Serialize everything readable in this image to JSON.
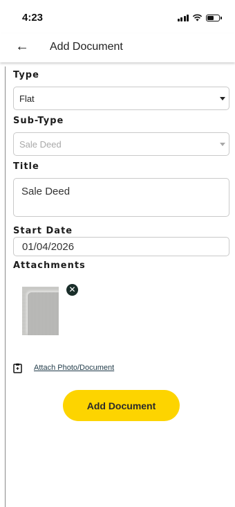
{
  "status_bar": {
    "time": "4:23"
  },
  "header": {
    "title": "Add Document"
  },
  "form": {
    "type": {
      "label": "Type",
      "value": "Flat"
    },
    "sub_type": {
      "label": "Sub-Type",
      "value": "Sale Deed"
    },
    "title": {
      "label": "Title",
      "value": "Sale Deed"
    },
    "start_date": {
      "label": "Start Date",
      "value": "01/04/2026"
    },
    "attachments": {
      "label": "Attachments",
      "count": 1
    }
  },
  "attach_link": "Attach Photo/Document",
  "submit_label": "Add Document",
  "colors": {
    "accent": "#fdd400",
    "remove_button": "#1a2e2a",
    "link": "#1f3a48"
  },
  "icons": [
    "back-arrow-icon",
    "signal-icon",
    "wifi-icon",
    "battery-icon",
    "close-icon",
    "clipboard-icon",
    "dropdown-caret-icon"
  ]
}
